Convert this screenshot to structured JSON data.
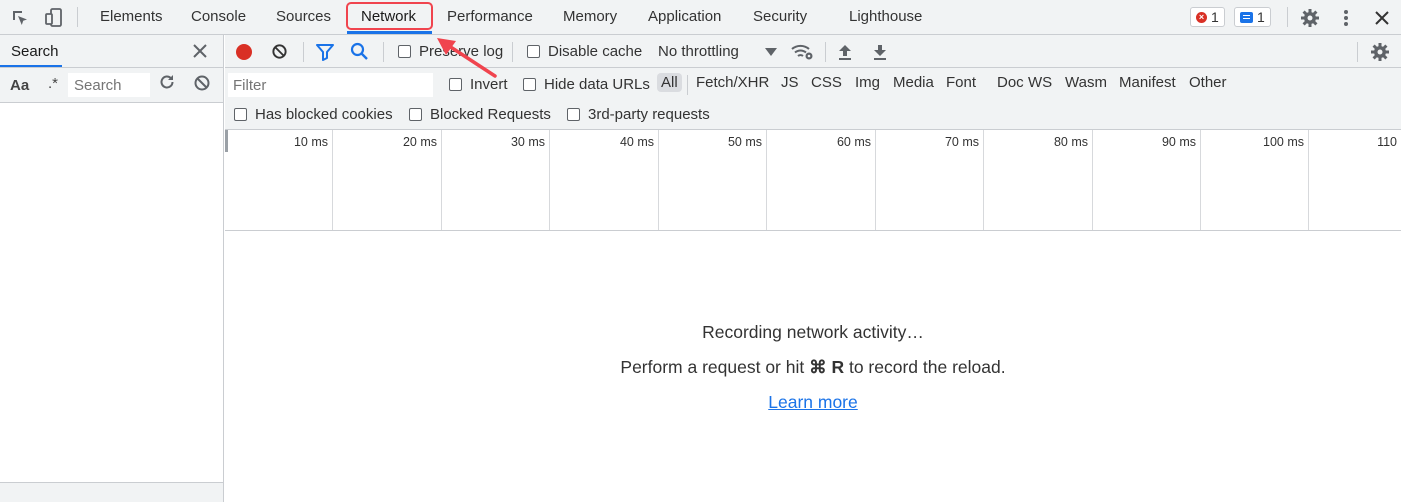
{
  "tabs": [
    {
      "label": "Elements"
    },
    {
      "label": "Console"
    },
    {
      "label": "Sources"
    },
    {
      "label": "Network"
    },
    {
      "label": "Performance"
    },
    {
      "label": "Memory"
    },
    {
      "label": "Application"
    },
    {
      "label": "Security"
    },
    {
      "label": "Lighthouse"
    }
  ],
  "badges": {
    "errors": "1",
    "messages": "1"
  },
  "search_panel": {
    "title": "Search",
    "match_case": "Aa",
    "regex": ".*",
    "placeholder": "Search"
  },
  "toolbar": {
    "preserve_log": "Preserve log",
    "disable_cache": "Disable cache",
    "throttling": "No throttling"
  },
  "filter": {
    "placeholder": "Filter",
    "invert": "Invert",
    "hide_data_urls": "Hide data URLs",
    "types": [
      "All",
      "Fetch/XHR",
      "JS",
      "CSS",
      "Img",
      "Media",
      "Font",
      "Doc",
      "WS",
      "Wasm",
      "Manifest",
      "Other"
    ],
    "has_blocked_cookies": "Has blocked cookies",
    "blocked_requests": "Blocked Requests",
    "third_party": "3rd-party requests"
  },
  "timeline": {
    "ticks": [
      "10 ms",
      "20 ms",
      "30 ms",
      "40 ms",
      "50 ms",
      "60 ms",
      "70 ms",
      "80 ms",
      "90 ms",
      "100 ms",
      "110"
    ]
  },
  "empty_state": {
    "recording": "Recording network activity…",
    "hint_prefix": "Perform a request or hit ",
    "hint_keys": "⌘ R",
    "hint_suffix": " to record the reload.",
    "learn_more": "Learn more"
  },
  "colors": {
    "accent": "#1a73e8",
    "record": "#d93025",
    "highlight": "#f0444e"
  }
}
